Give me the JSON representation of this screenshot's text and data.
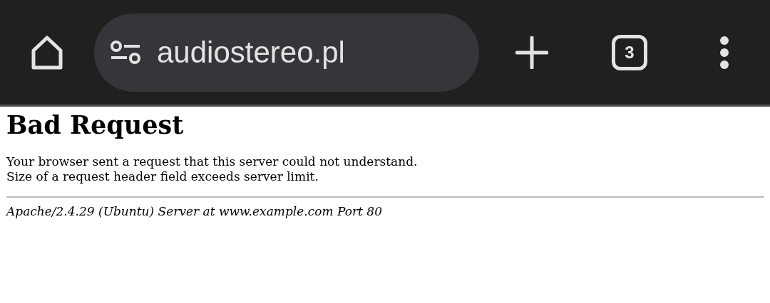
{
  "toolbar": {
    "url": "audiostereo.pl",
    "tab_count": "3"
  },
  "page": {
    "heading": "Bad Request",
    "message_lines": [
      "Your browser sent a request that this server could not understand.",
      "Size of a request header field exceeds server limit."
    ],
    "server_signature": "Apache/2.4.29 (Ubuntu) Server at www.example.com Port 80"
  }
}
